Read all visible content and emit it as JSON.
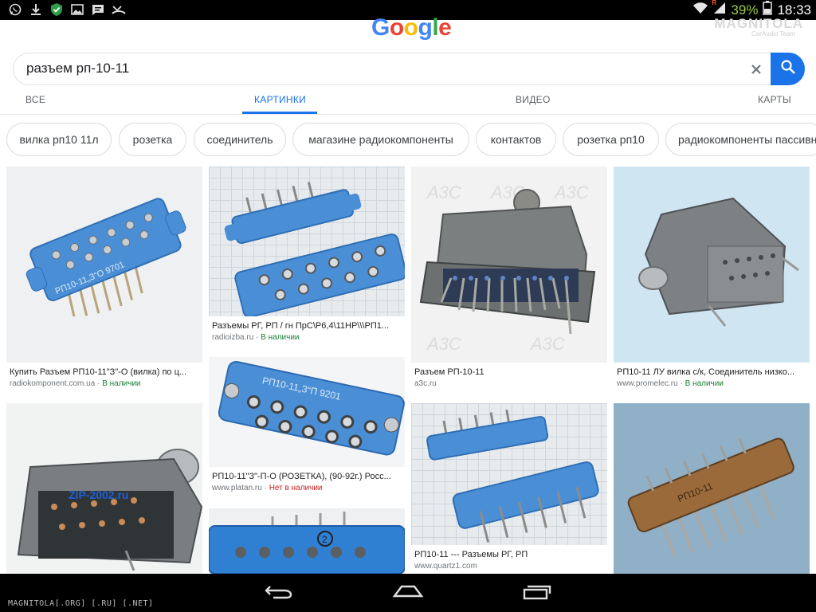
{
  "status_bar": {
    "battery": "39%",
    "time": "18:33",
    "left_icons": [
      "whatsapp-icon",
      "download-icon",
      "shield-icon",
      "image-icon",
      "message-icon",
      "missed-call-icon"
    ],
    "signal_badge": "R"
  },
  "watermark": {
    "logo": "MAGNITOLA",
    "sub": "CarAudio Team",
    "footer": "MAGNITOLA[.ORG] [.RU] [.NET]"
  },
  "google": {
    "logo_letters": [
      "G",
      "o",
      "o",
      "g",
      "l",
      "e"
    ],
    "logo_colors": [
      "#4285f4",
      "#ea4335",
      "#fbbc05",
      "#4285f4",
      "#34a853",
      "#ea4335"
    ]
  },
  "search": {
    "query": "разъем рп-10-11"
  },
  "tabs": [
    {
      "label": "ВСЕ"
    },
    {
      "label": "КАРТИНКИ"
    },
    {
      "label": "ВИДЕО"
    },
    {
      "label": "КАРТЫ"
    }
  ],
  "chips": [
    "вилка рп10 11л",
    "розетка",
    "соединитель",
    "магазине радиокомпоненты",
    "контактов",
    "розетка рп10",
    "радиокомпоненты пассивн"
  ],
  "results": [
    {
      "caption": "Купить Разъем РП10-11\"З\"-О (вилка) по ц...",
      "source": "radiokomponent.com.ua",
      "status": "В наличии"
    },
    {
      "caption": "Разъемы РГ, РП / гн ПрС\\Р6,4\\11НР\\\\\\РП1...",
      "source": "radioizba.ru",
      "status": "В наличии"
    },
    {
      "caption": "Разъем РП-10-11",
      "source": "a3c.ru",
      "status": ""
    },
    {
      "caption": "РП10-11 ЛУ вилка с/к, Соединитель низко...",
      "source": "www.promelec.ru",
      "status": "В наличии"
    },
    {
      "caption": "РП10-11\"З\"-П-О (РОЗЕТКА), (90-92г.) Росс...",
      "source": "www.platan.ru",
      "status": "Нет в наличии"
    },
    {
      "caption": "РП10-11 --- Разъемы РГ, РП",
      "source": "www.quartz1.com",
      "status": ""
    },
    {
      "caption": "",
      "source": "",
      "status": ""
    },
    {
      "caption": "",
      "source": "",
      "status": ""
    },
    {
      "caption": "",
      "source": "",
      "status": ""
    }
  ],
  "image_marks": {
    "marking_1": "РП10-11„З“О 9701",
    "marking_2": "РП10-11„З“П 9201",
    "marking_3": "РП10-11",
    "watermark_zip": "ZIP-2002.ru",
    "pin_label_2": "2"
  },
  "colors": {
    "accent": "#1a73e8",
    "connector_blue": "#4a8fd6",
    "connector_grey": "#7c7f80",
    "connector_brown": "#9a6a3a"
  }
}
